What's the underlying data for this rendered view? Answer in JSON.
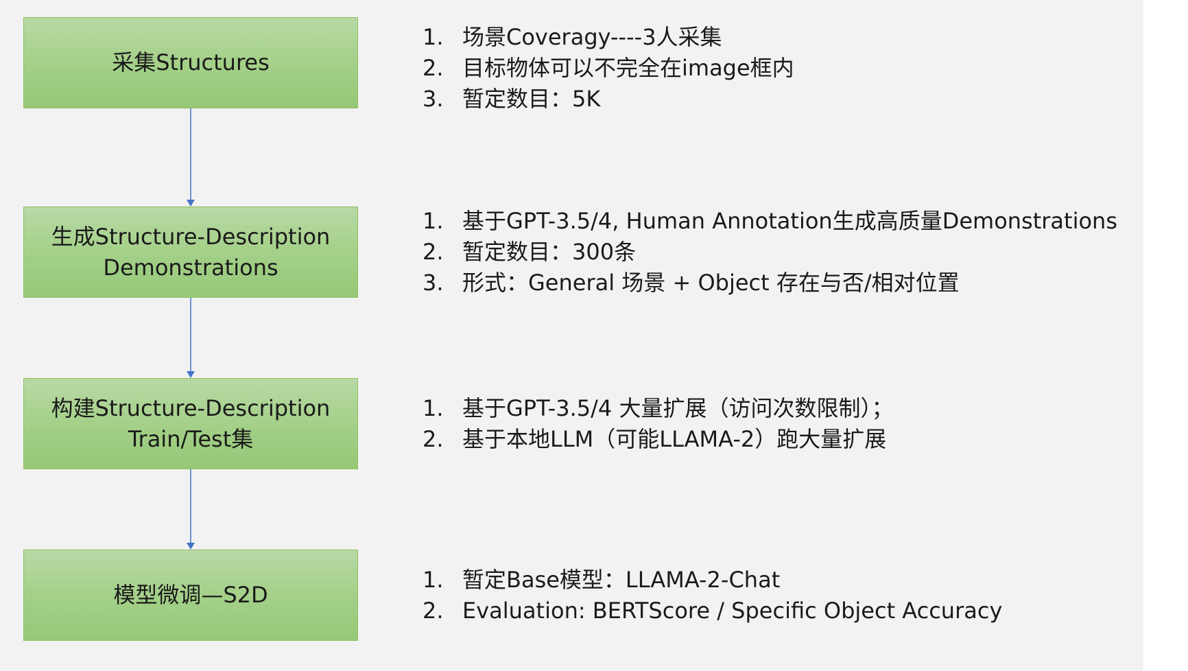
{
  "stages": [
    {
      "box_label": "采集Structures",
      "items": [
        "场景Coveragy----3人采集",
        "目标物体可以不完全在image框内",
        "暂定数目：5K"
      ]
    },
    {
      "box_label": "生成Structure-Description\nDemonstrations",
      "items": [
        "基于GPT-3.5/4, Human Annotation生成高质量Demonstrations",
        "暂定数目：300条",
        "形式：General 场景 + Object 存在与否/相对位置"
      ]
    },
    {
      "box_label": "构建Structure-Description\nTrain/Test集",
      "items": [
        "基于GPT-3.5/4 大量扩展（访问次数限制）；",
        "基于本地LLM（可能LLAMA-2）跑大量扩展"
      ]
    },
    {
      "box_label": "模型微调—S2D",
      "items": [
        "暂定Base模型：LLAMA-2-Chat",
        "Evaluation: BERTScore / Specific Object Accuracy"
      ]
    }
  ],
  "numbers": [
    "1.",
    "2.",
    "3."
  ],
  "colors": {
    "box_fill_top": "#b8d9a6",
    "box_fill_bottom": "#95c877",
    "box_border": "#8fbf5f",
    "arrow": "#4472c4",
    "slide_background": "#f2f2f2"
  }
}
